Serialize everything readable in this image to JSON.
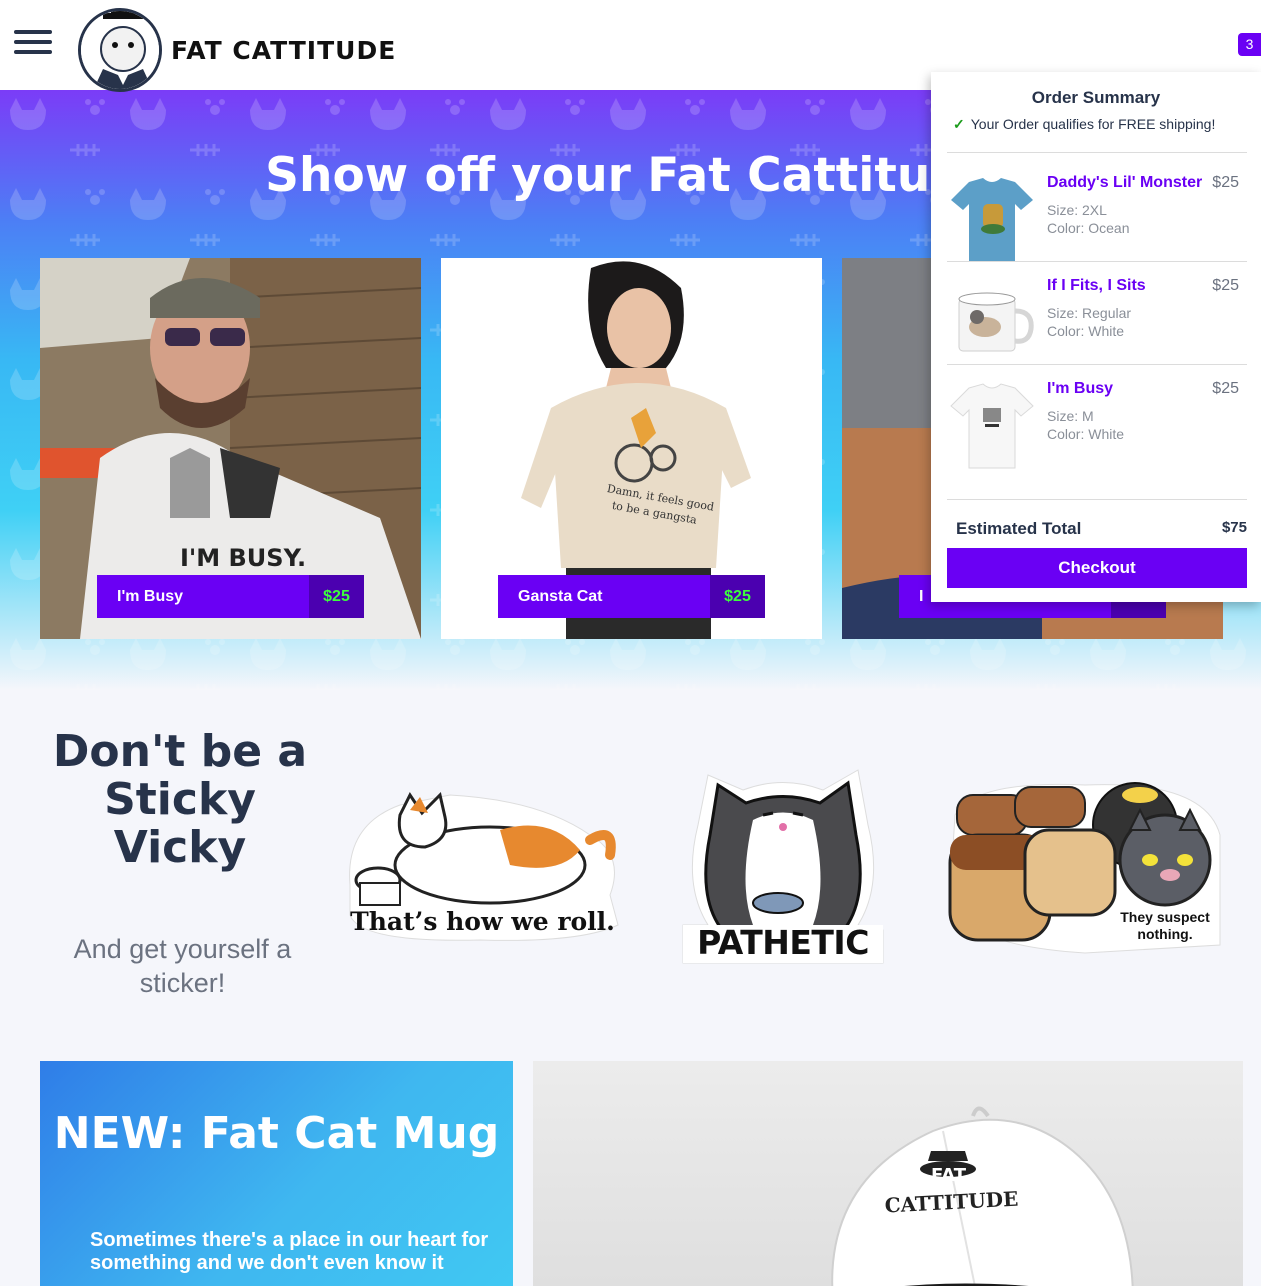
{
  "header": {
    "brand": "FAT CATTITUDE",
    "cart_count": "3"
  },
  "hero": {
    "title": "Show off your Fat Cattitude",
    "products": [
      {
        "name": "I'm Busy",
        "price": "$25"
      },
      {
        "name": "Gansta Cat",
        "price": "$25"
      },
      {
        "name": "I",
        "price": ""
      }
    ]
  },
  "stickers": {
    "title_lines": [
      "Don't be a",
      "Sticky",
      "Vicky"
    ],
    "subtitle": "And get yourself a sticker!",
    "items": [
      {
        "caption": "That’s how we roll."
      },
      {
        "caption": "PATHETIC"
      },
      {
        "caption": "They suspect nothing."
      }
    ]
  },
  "promo": {
    "title": "NEW: Fat Cat Mug",
    "text": "Sometimes there's a place in our heart for something and we don't even know it"
  },
  "hat_panel": {
    "cap_text_1": "FAT",
    "cap_text_2": "CATTITUDE"
  },
  "cart": {
    "title": "Order Summary",
    "shipping_note": "Your Order qualifies for FREE shipping!",
    "items": [
      {
        "name": "Daddy's Lil' Monster",
        "price": "$25",
        "size": "Size: 2XL",
        "color": "Color: Ocean"
      },
      {
        "name": "If I Fits, I Sits",
        "price": "$25",
        "size": "Size: Regular",
        "color": "Color: White"
      },
      {
        "name": "I'm Busy",
        "price": "$25",
        "size": "Size: M",
        "color": "Color: White"
      }
    ],
    "total_label": "Estimated Total",
    "total_value": "$75",
    "checkout_label": "Checkout"
  },
  "colors": {
    "accent": "#6a00f4",
    "price_green": "#3cff3c",
    "text_dark": "#27334a"
  },
  "icons": [
    "menu-icon",
    "cart-bag-icon",
    "check-icon"
  ]
}
